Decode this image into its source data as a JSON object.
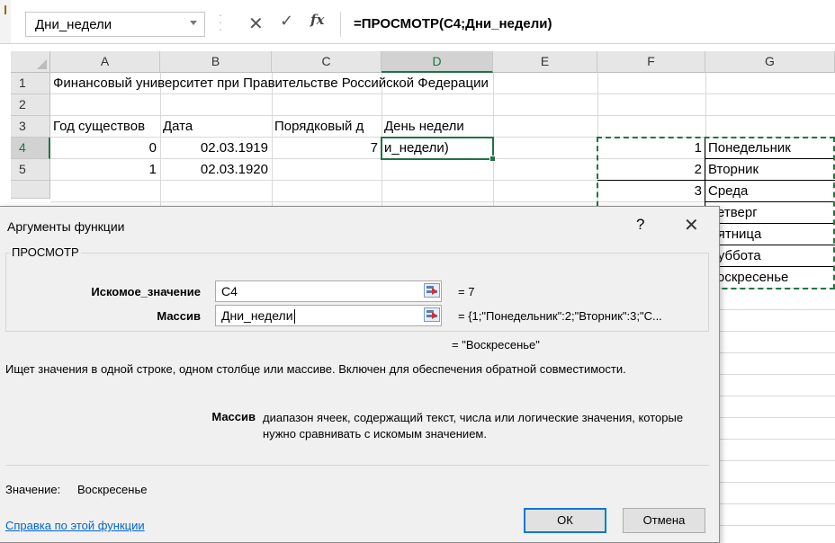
{
  "formula_bar": {
    "name_box": "Дни_недели",
    "cancel_glyph": "✕",
    "enter_glyph": "✓",
    "fx_label": "fx",
    "formula": "=ПРОСМОТР(C4;Дни_недели)"
  },
  "sheet": {
    "columns": [
      "A",
      "B",
      "C",
      "D",
      "E",
      "F",
      "G"
    ],
    "rows": [
      "1",
      "2",
      "3",
      "4",
      "5",
      "6"
    ],
    "cells": {
      "A1": "Финансовый университет при Правительстве Российской Федерации",
      "A3": "Год существов",
      "B3": "Дата",
      "C3": "Порядковый д",
      "D3": "День недели",
      "A4": "0",
      "B4": "02.03.1919",
      "C4": "7",
      "D4": "и_недели)",
      "A5": "1",
      "B5": "02.03.1920",
      "F4": "1",
      "G4": "Понедельник",
      "F5": "2",
      "G5": "Вторник",
      "F6": "3",
      "G6": "Среда",
      "G7": "Четверг",
      "G8": "Пятница",
      "G9": "Суббота",
      "G10": "Воскресенье"
    }
  },
  "dialog": {
    "title": "Аргументы функции",
    "help_glyph": "?",
    "close_glyph": "✕",
    "function_name": "ПРОСМОТР",
    "arg1": {
      "label": "Искомое_значение",
      "value": "C4",
      "result": "=  7"
    },
    "arg2": {
      "label": "Массив",
      "value": "Дни_недели",
      "result": "=  {1;\"Понедельник\":2;\"Вторник\":3;\"С..."
    },
    "formula_result": "=  \"Воскресенье\"",
    "description": "Ищет значения в одной строке, одном столбце или массиве. Включен для обеспечения обратной совместимости.",
    "arg_help_name": "Массив",
    "arg_help_text": "диапазон ячеек, содержащий текст, числа или логические значения, которые нужно сравнивать с искомым значением.",
    "value_label": "Значение:",
    "value": "Воскресенье",
    "help_link": "Справка по этой функции",
    "ok_label": "ОК",
    "cancel_label": "Отмена"
  },
  "colors": {
    "accent": "#217346",
    "link": "#0066cc",
    "default_button_border": "#0078d7"
  }
}
